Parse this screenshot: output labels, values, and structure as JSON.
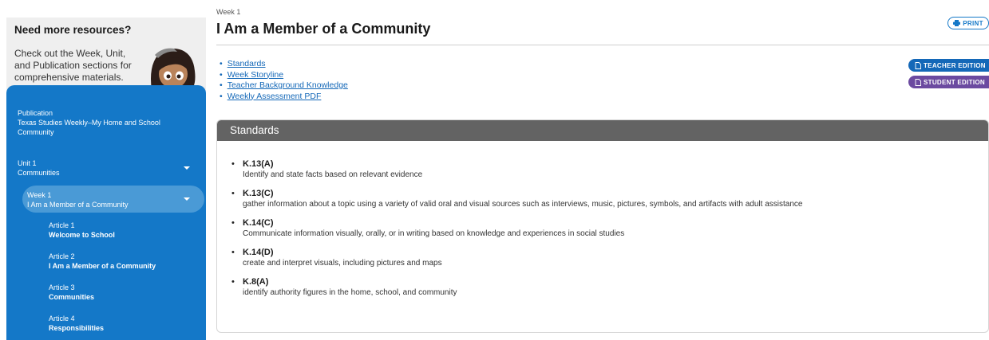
{
  "sidebar": {
    "help": {
      "title": "Need more resources?",
      "text": "Check out the Week, Unit, and Publication sections for comprehensive materials."
    },
    "publication": {
      "label": "Publication",
      "title": "Texas Studies Weekly–My Home and School Community"
    },
    "unit": {
      "label": "Unit 1",
      "title": "Communities"
    },
    "week": {
      "label": "Week 1",
      "title": "I Am a Member of a Community"
    },
    "articles": [
      {
        "label": "Article 1",
        "title": "Welcome to School"
      },
      {
        "label": "Article 2",
        "title": "I Am a Member of a Community"
      },
      {
        "label": "Article 3",
        "title": "Communities"
      },
      {
        "label": "Article 4",
        "title": "Responsibilities"
      }
    ]
  },
  "header": {
    "week_label": "Week 1",
    "title": "I Am a Member of a Community",
    "print_label": "PRINT"
  },
  "editions": {
    "teacher_label": "TEACHER EDITION",
    "student_label": "STUDENT EDITION"
  },
  "links": [
    {
      "label": "Standards"
    },
    {
      "label": "Week Storyline"
    },
    {
      "label": "Teacher Background Knowledge"
    },
    {
      "label": "Weekly Assessment PDF"
    }
  ],
  "standards": {
    "header": "Standards",
    "items": [
      {
        "code": "K.13(A)",
        "description": "Identify and state facts based on relevant evidence"
      },
      {
        "code": "K.13(C)",
        "description": "gather information about a topic using a variety of valid oral and visual sources such as interviews, music, pictures, symbols, and artifacts with adult assistance"
      },
      {
        "code": "K.14(C)",
        "description": "Communicate information visually, orally, or in writing based on knowledge and experiences in social studies"
      },
      {
        "code": "K.14(D)",
        "description": "create and interpret visuals, including pictures and maps"
      },
      {
        "code": "K.8(A)",
        "description": "identify authority figures in the home, school, and community"
      }
    ]
  },
  "colors": {
    "nav_blue": "#1478c8",
    "teacher_blue": "#1468b8",
    "student_purple": "#6b4aa0",
    "standards_header": "#636363"
  }
}
